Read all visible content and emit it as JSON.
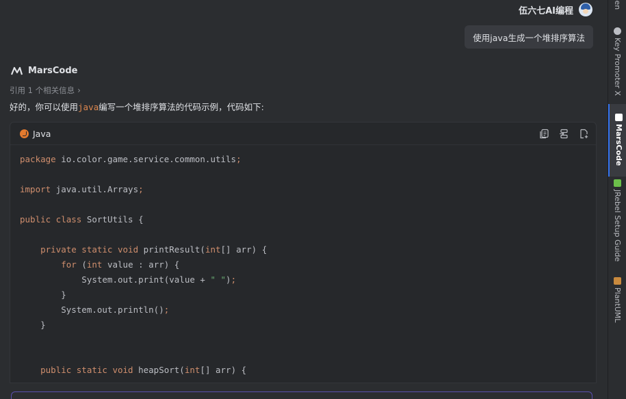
{
  "user": {
    "name": "伍六七AI编程",
    "message": "使用java生成一个堆排序算法"
  },
  "assistant": {
    "name": "MarsCode",
    "reference": "引用 1 个相关信息",
    "answer_prefix": "好的，你可以使用",
    "answer_code": "java",
    "answer_suffix": "编写一个堆排序算法的代码示例，代码如下:"
  },
  "code_block": {
    "language": "Java",
    "actions": [
      "copy-icon",
      "insert-icon",
      "new-file-icon"
    ],
    "lines": [
      [
        {
          "t": "package",
          "c": "kw"
        },
        {
          "t": " io.color.game.service.common.utils",
          "c": "pl"
        },
        {
          "t": ";",
          "c": "kw"
        }
      ],
      [],
      [
        {
          "t": "import",
          "c": "kw"
        },
        {
          "t": " java.util.Arrays",
          "c": "pl"
        },
        {
          "t": ";",
          "c": "kw"
        }
      ],
      [],
      [
        {
          "t": "public class",
          "c": "kw"
        },
        {
          "t": " SortUtils {",
          "c": "pl"
        }
      ],
      [],
      [
        {
          "t": "    private static void",
          "c": "kw"
        },
        {
          "t": " printResult(",
          "c": "pl"
        },
        {
          "t": "int",
          "c": "kw"
        },
        {
          "t": "[] arr) {",
          "c": "pl"
        }
      ],
      [
        {
          "t": "        for",
          "c": "kw"
        },
        {
          "t": " (",
          "c": "pl"
        },
        {
          "t": "int",
          "c": "kw"
        },
        {
          "t": " value : arr) {",
          "c": "pl"
        }
      ],
      [
        {
          "t": "            System.out.print(value + ",
          "c": "pl"
        },
        {
          "t": "\" \"",
          "c": "st"
        },
        {
          "t": ")",
          "c": "pl"
        },
        {
          "t": ";",
          "c": "kw"
        }
      ],
      [
        {
          "t": "        }",
          "c": "pl"
        }
      ],
      [
        {
          "t": "        System.out.println()",
          "c": "pl"
        },
        {
          "t": ";",
          "c": "kw"
        }
      ],
      [
        {
          "t": "    }",
          "c": "pl"
        }
      ],
      [],
      [],
      [
        {
          "t": "    public static void",
          "c": "kw"
        },
        {
          "t": " heapSort(",
          "c": "pl"
        },
        {
          "t": "int",
          "c": "kw"
        },
        {
          "t": "[] arr) {",
          "c": "pl"
        }
      ]
    ]
  },
  "right_rail": [
    {
      "label": "ven",
      "icon": "maven-icon"
    },
    {
      "label": "Key Promoter X",
      "icon": "key-promoter-icon"
    },
    {
      "label": "MarsCode",
      "icon": "marscode-icon",
      "active": true
    },
    {
      "label": "JRebel Setup Guide",
      "icon": "jrebel-icon"
    },
    {
      "label": "PlantUML",
      "icon": "plantuml-icon"
    }
  ],
  "colors": {
    "background": "#2b2d30",
    "code_background": "#26282b",
    "keyword": "#cf8e6d",
    "string": "#6aab73",
    "inline_code": "#e0884f",
    "accent": "#3574f0"
  }
}
